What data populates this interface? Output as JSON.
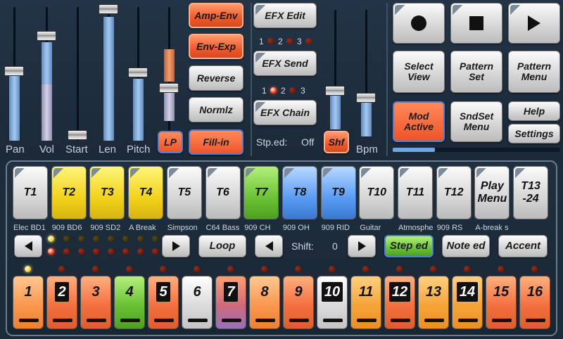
{
  "sliders": [
    {
      "label": "Pan",
      "level": 0.55
    },
    {
      "label": "Vol",
      "level": 0.8
    },
    {
      "label": "Start",
      "level": 0.0
    },
    {
      "label": "Len",
      "level": 0.95
    },
    {
      "label": "Pitch",
      "level": 0.48
    }
  ],
  "envelope": {
    "amp_env": "Amp-Env",
    "env_exp": "Env-Exp",
    "reverse": "Reverse",
    "normlz": "Normlz",
    "lp": "LP",
    "fill_in": "Fill-in"
  },
  "efx": {
    "edit": "EFX Edit",
    "send": "EFX Send",
    "chain": "EFX Chain",
    "row1": [
      "1",
      "2",
      "3"
    ],
    "row2": [
      "1",
      "2",
      "3"
    ]
  },
  "step_edit": {
    "label": "Stp.ed:",
    "value": "Off",
    "shf": "Shf"
  },
  "bpm": {
    "label": "Bpm"
  },
  "transport": {
    "select_view": "Select View",
    "pattern_set": "Pattern Set",
    "pattern_menu": "Pattern Menu",
    "mod_active": "Mod Active",
    "sndset_menu": "SndSet Menu",
    "help": "Help",
    "settings": "Settings"
  },
  "tracks": [
    {
      "label": "T1",
      "name": "Elec BD1",
      "color": "grey"
    },
    {
      "label": "T2",
      "name": "909 BD6",
      "color": "yellow"
    },
    {
      "label": "T3",
      "name": "909 SD2",
      "color": "yellow"
    },
    {
      "label": "T4",
      "name": "A Break",
      "color": "yellow"
    },
    {
      "label": "T5",
      "name": "Simpson",
      "color": "grey"
    },
    {
      "label": "T6",
      "name": "C64 Bass",
      "color": "grey"
    },
    {
      "label": "T7",
      "name": "909 CH",
      "color": "green"
    },
    {
      "label": "T8",
      "name": "909 OH",
      "color": "blue"
    },
    {
      "label": "T9",
      "name": "909 RID",
      "color": "blue"
    },
    {
      "label": "T10",
      "name": "Guitar",
      "color": "grey"
    },
    {
      "label": "T11",
      "name": "Atmosphe",
      "color": "grey"
    },
    {
      "label": "T12",
      "name": "909 RS",
      "color": "grey"
    },
    {
      "label": "Play Menu",
      "name": "A-break s",
      "color": "grey"
    },
    {
      "label": "T13 -24",
      "name": "",
      "color": "grey"
    }
  ],
  "pattern_controls": {
    "loop": "Loop",
    "shift_label": "Shift:",
    "shift_value": "0",
    "step_ed": "Step ed",
    "note_ed": "Note ed",
    "accent": "Accent"
  },
  "steps": [
    {
      "n": "1",
      "style": "peach",
      "boxed": false
    },
    {
      "n": "2",
      "style": "orange",
      "boxed": true
    },
    {
      "n": "3",
      "style": "orange",
      "boxed": false
    },
    {
      "n": "4",
      "style": "green",
      "boxed": false
    },
    {
      "n": "5",
      "style": "orange",
      "boxed": true
    },
    {
      "n": "6",
      "style": "grey",
      "boxed": false
    },
    {
      "n": "7",
      "style": "purple",
      "boxed": true
    },
    {
      "n": "8",
      "style": "peach",
      "boxed": false
    },
    {
      "n": "9",
      "style": "orange",
      "boxed": false
    },
    {
      "n": "10",
      "style": "grey",
      "boxed": true
    },
    {
      "n": "11",
      "style": "yellow",
      "boxed": false
    },
    {
      "n": "12",
      "style": "orange",
      "boxed": true
    },
    {
      "n": "13",
      "style": "yellow",
      "boxed": false
    },
    {
      "n": "14",
      "style": "yellow",
      "boxed": true
    },
    {
      "n": "15",
      "style": "orange",
      "boxed": false
    },
    {
      "n": "16",
      "style": "orange",
      "boxed": false
    }
  ]
}
